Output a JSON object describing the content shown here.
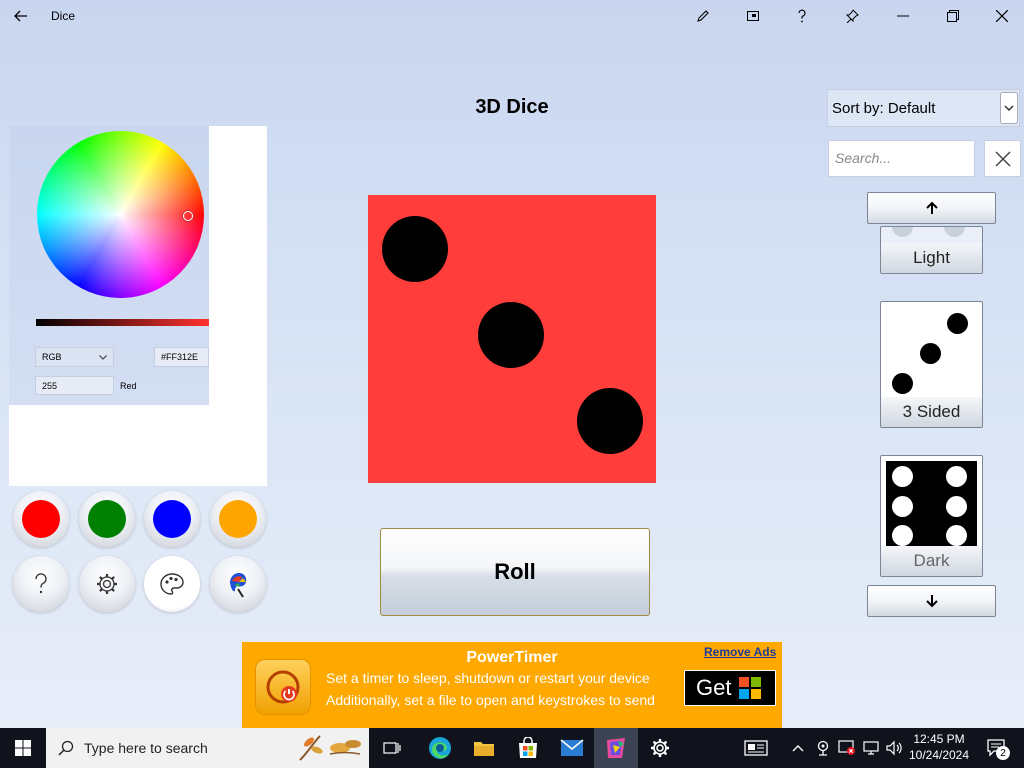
{
  "window": {
    "title": "Dice",
    "icons": [
      "back-arrow-icon",
      "pen-icon",
      "compact-overlay-icon",
      "help-icon",
      "pin-icon",
      "minimize-icon",
      "restore-icon",
      "close-icon"
    ]
  },
  "app_title": "3D Dice",
  "color_picker": {
    "mode": "RGB",
    "hex": "#FF312E",
    "channel_value": "255",
    "channel_label": "Red",
    "selected_color": "#FF312E"
  },
  "swatches": [
    {
      "name": "red",
      "color": "#ff0000"
    },
    {
      "name": "green",
      "color": "#008000"
    },
    {
      "name": "blue",
      "color": "#0000ff"
    },
    {
      "name": "orange",
      "color": "#ffa500"
    }
  ],
  "tools": [
    "help-icon",
    "settings-gear-icon",
    "palette-icon",
    "paint-app-icon"
  ],
  "die": {
    "face_value": 3,
    "color": "#ff3d3a",
    "pip_color": "#000000"
  },
  "roll_label": "Roll",
  "sort": {
    "label": "Sort by: Default"
  },
  "search": {
    "placeholder": "Search..."
  },
  "themes": [
    {
      "label": "Light"
    },
    {
      "label": "3 Sided"
    },
    {
      "label": "Dark"
    }
  ],
  "ad": {
    "title": "PowerTimer",
    "line1": "Set a timer to sleep, shutdown or restart your device",
    "line2": "Additionally, set a file to open and keystrokes to send",
    "remove_label": "Remove Ads",
    "get_label": "Get",
    "background": "#ffa800"
  },
  "taskbar": {
    "search_placeholder": "Type here to search",
    "time": "12:45 PM",
    "date": "10/24/2024",
    "notification_count": "2"
  }
}
